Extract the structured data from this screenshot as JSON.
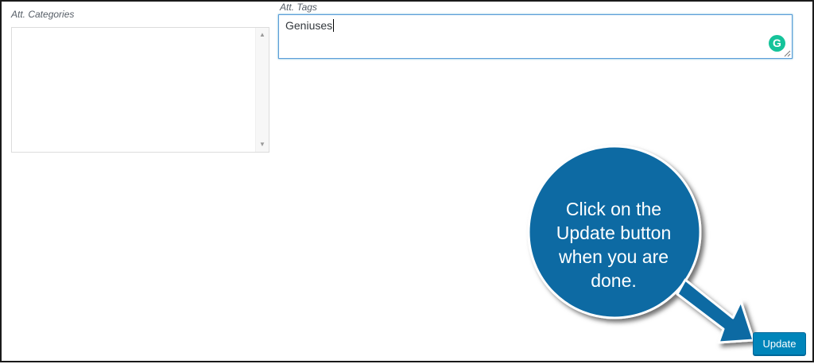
{
  "fields": {
    "categories_label": "Att. Categories",
    "tags_label": "Att. Tags",
    "tags_value": "Geniuses"
  },
  "grammarly_badge": "G",
  "callout": {
    "line1": "Click on the",
    "line2": "Update button",
    "line3": "when you are",
    "line4": "done."
  },
  "actions": {
    "update_label": "Update"
  },
  "colors": {
    "callout_fill": "#0e6aa3",
    "button_fill": "#0085ba",
    "grammarly": "#15c39a",
    "focus_border": "#5b9dd9"
  }
}
